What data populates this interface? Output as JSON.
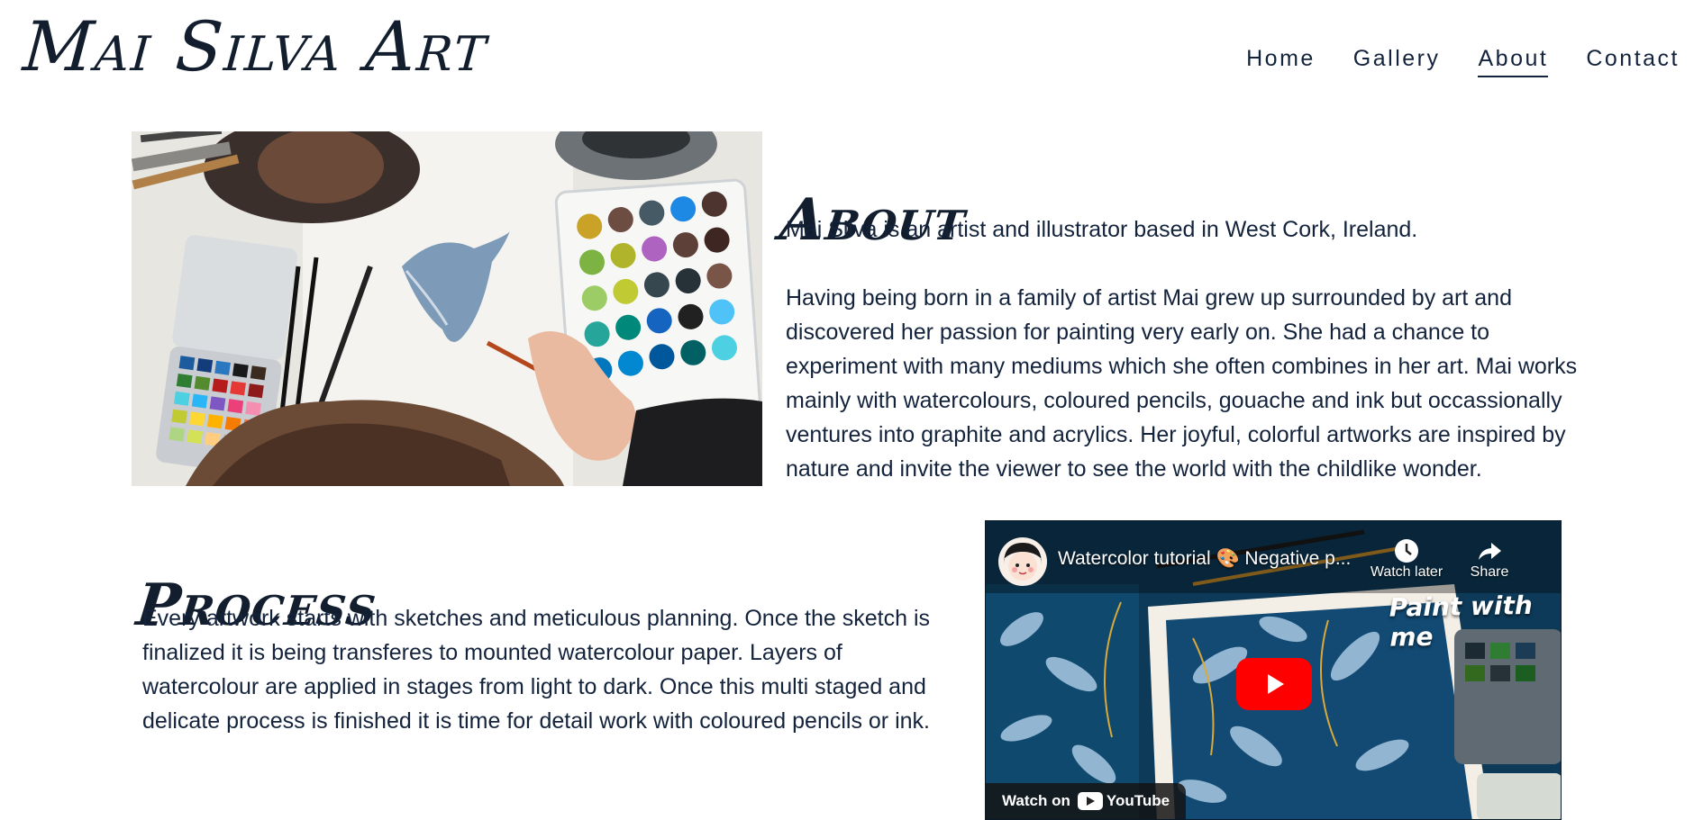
{
  "site": {
    "logo": "Mai Silva Art"
  },
  "nav": {
    "items": [
      {
        "label": "Home",
        "active": false
      },
      {
        "label": "Gallery",
        "active": false
      },
      {
        "label": "About",
        "active": true
      },
      {
        "label": "Contact",
        "active": false
      }
    ]
  },
  "about": {
    "heading": "About",
    "paragraph1": "Mai Silva is an artist and illustrator based in West Cork, Ireland.",
    "paragraph2": "Having being born in a family of artist Mai grew up surrounded by art and discovered her passion for painting very early on. She had a chance to experiment with many mediums which she often combines in her art. Mai works mainly with watercolours, coloured pencils, gouache and ink but occassionally ventures into graphite and acrylics. Her joyful, colorful artworks are inspired by nature and invite the viewer to see the world with the childlike wonder."
  },
  "process": {
    "heading": "Process",
    "paragraph": "Every artwork starts with sketches and meticulous planning. Once the sketch is finalized it is being transferes to mounted watercolour paper. Layers of watercolour are applied in stages from light to dark. Once this multi staged and delicate process is finished it is time for detail work with coloured pencils or ink."
  },
  "video": {
    "title": "Watercolor tutorial 🎨 Negative p...",
    "watch_later": "Watch later",
    "share": "Share",
    "overlay_text": "Paint with me",
    "watch_on": "Watch on",
    "youtube": "YouTube"
  },
  "colors": {
    "text": "#14233c",
    "youtube_red": "#ff0000"
  }
}
